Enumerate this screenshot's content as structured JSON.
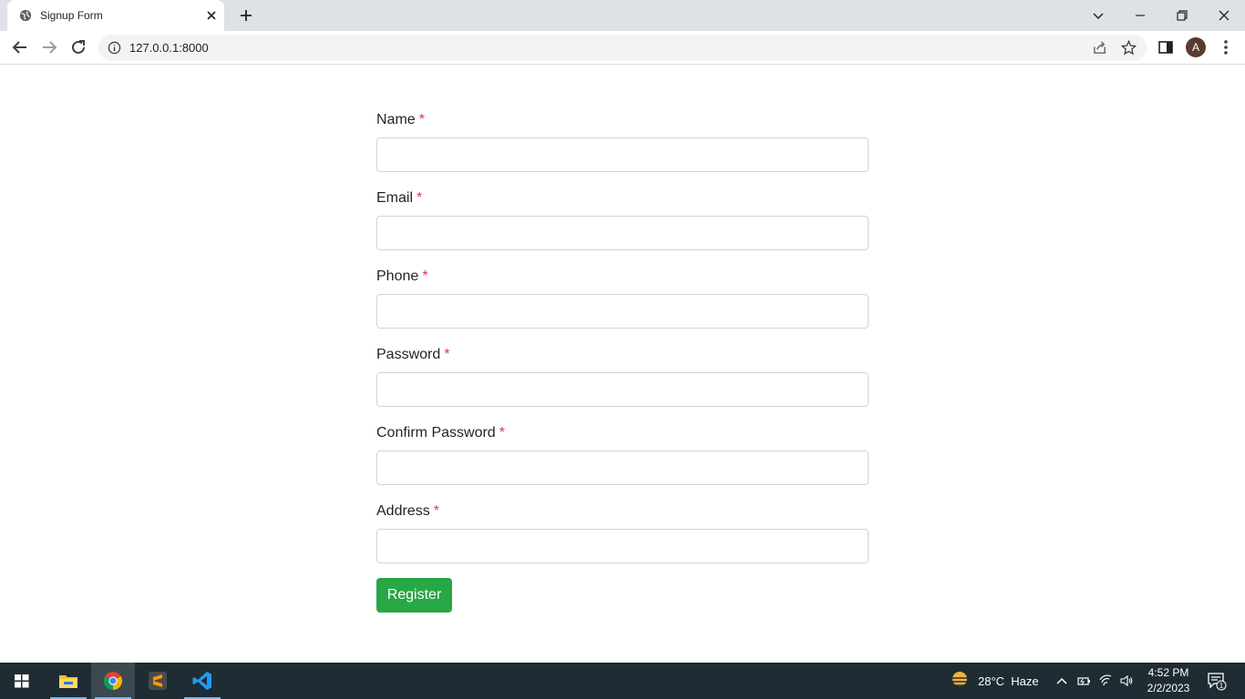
{
  "browser": {
    "tab_title": "Signup Form",
    "url": "127.0.0.1:8000",
    "profile_initial": "A"
  },
  "form": {
    "fields": [
      {
        "label": "Name",
        "required_mark": "*",
        "value": ""
      },
      {
        "label": "Email",
        "required_mark": "*",
        "value": ""
      },
      {
        "label": "Phone",
        "required_mark": "*",
        "value": ""
      },
      {
        "label": "Password",
        "required_mark": "*",
        "value": ""
      },
      {
        "label": "Confirm Password",
        "required_mark": "*",
        "value": ""
      },
      {
        "label": "Address",
        "required_mark": "*",
        "value": ""
      }
    ],
    "submit_label": "Register"
  },
  "taskbar": {
    "apps": [
      "start-icon",
      "file-explorer-icon",
      "chrome-icon",
      "sublime-text-icon",
      "vscode-icon"
    ],
    "weather": "28°C  Haze",
    "time": "4:52 PM",
    "date": "2/2/2023",
    "notification_count": "1"
  },
  "colors": {
    "register_button": "#28a745",
    "required_asterisk": "#dc3545",
    "taskbar": "#1f2c33"
  }
}
